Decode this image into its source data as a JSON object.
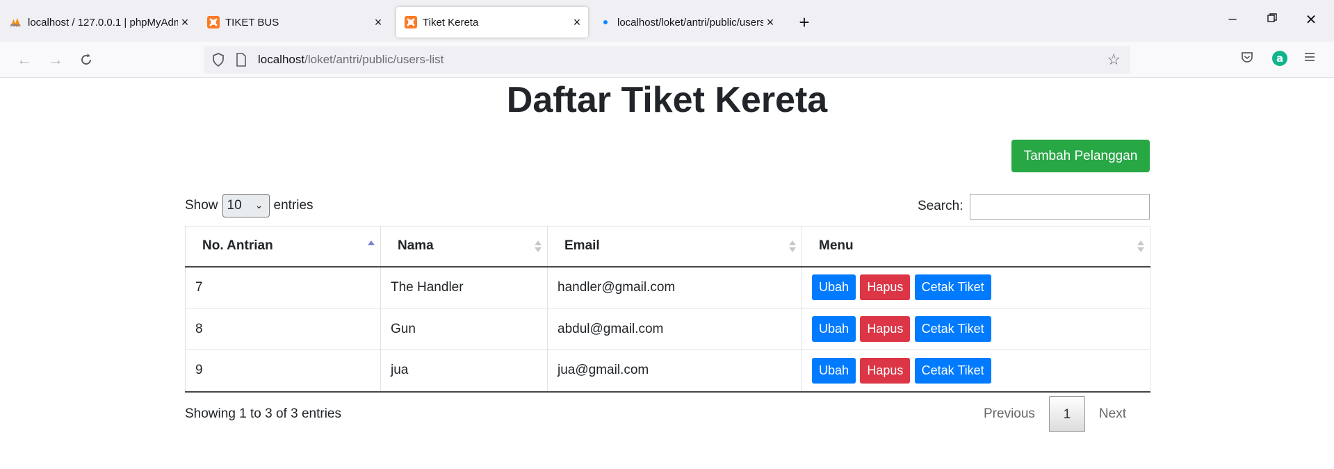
{
  "browser": {
    "tabs": [
      {
        "label": "localhost / 127.0.0.1 | phpMyAdmin",
        "favicon": "phpmyadmin-icon",
        "active": false
      },
      {
        "label": "TIKET BUS",
        "favicon": "xampp-icon",
        "active": false
      },
      {
        "label": "Tiket Kereta",
        "favicon": "xampp-icon",
        "active": true
      },
      {
        "label": "localhost/loket/antri/public/users-list",
        "favicon": "loading-dot-icon",
        "active": false
      }
    ],
    "url_host": "localhost",
    "url_path": "/loket/antri/public/users-list"
  },
  "page": {
    "title": "Daftar Tiket Kereta",
    "add_button": "Tambah Pelanggan",
    "show_label": "Show",
    "entries_label": "entries",
    "page_length": "10",
    "search_label": "Search:",
    "search_value": ""
  },
  "table": {
    "headers": [
      "No. Antrian",
      "Nama",
      "Email",
      "Menu"
    ],
    "rows": [
      {
        "no": "7",
        "nama": "The Handler",
        "email": "handler@gmail.com"
      },
      {
        "no": "8",
        "nama": "Gun",
        "email": "abdul@gmail.com"
      },
      {
        "no": "9",
        "nama": "jua",
        "email": "jua@gmail.com"
      }
    ],
    "actions": {
      "edit": "Ubah",
      "delete": "Hapus",
      "print": "Cetak Tiket"
    }
  },
  "footer": {
    "info": "Showing 1 to 3 of 3 entries",
    "previous": "Previous",
    "current_page": "1",
    "next": "Next"
  },
  "colors": {
    "success": "#28a745",
    "primary": "#007bff",
    "danger": "#dc3545"
  }
}
